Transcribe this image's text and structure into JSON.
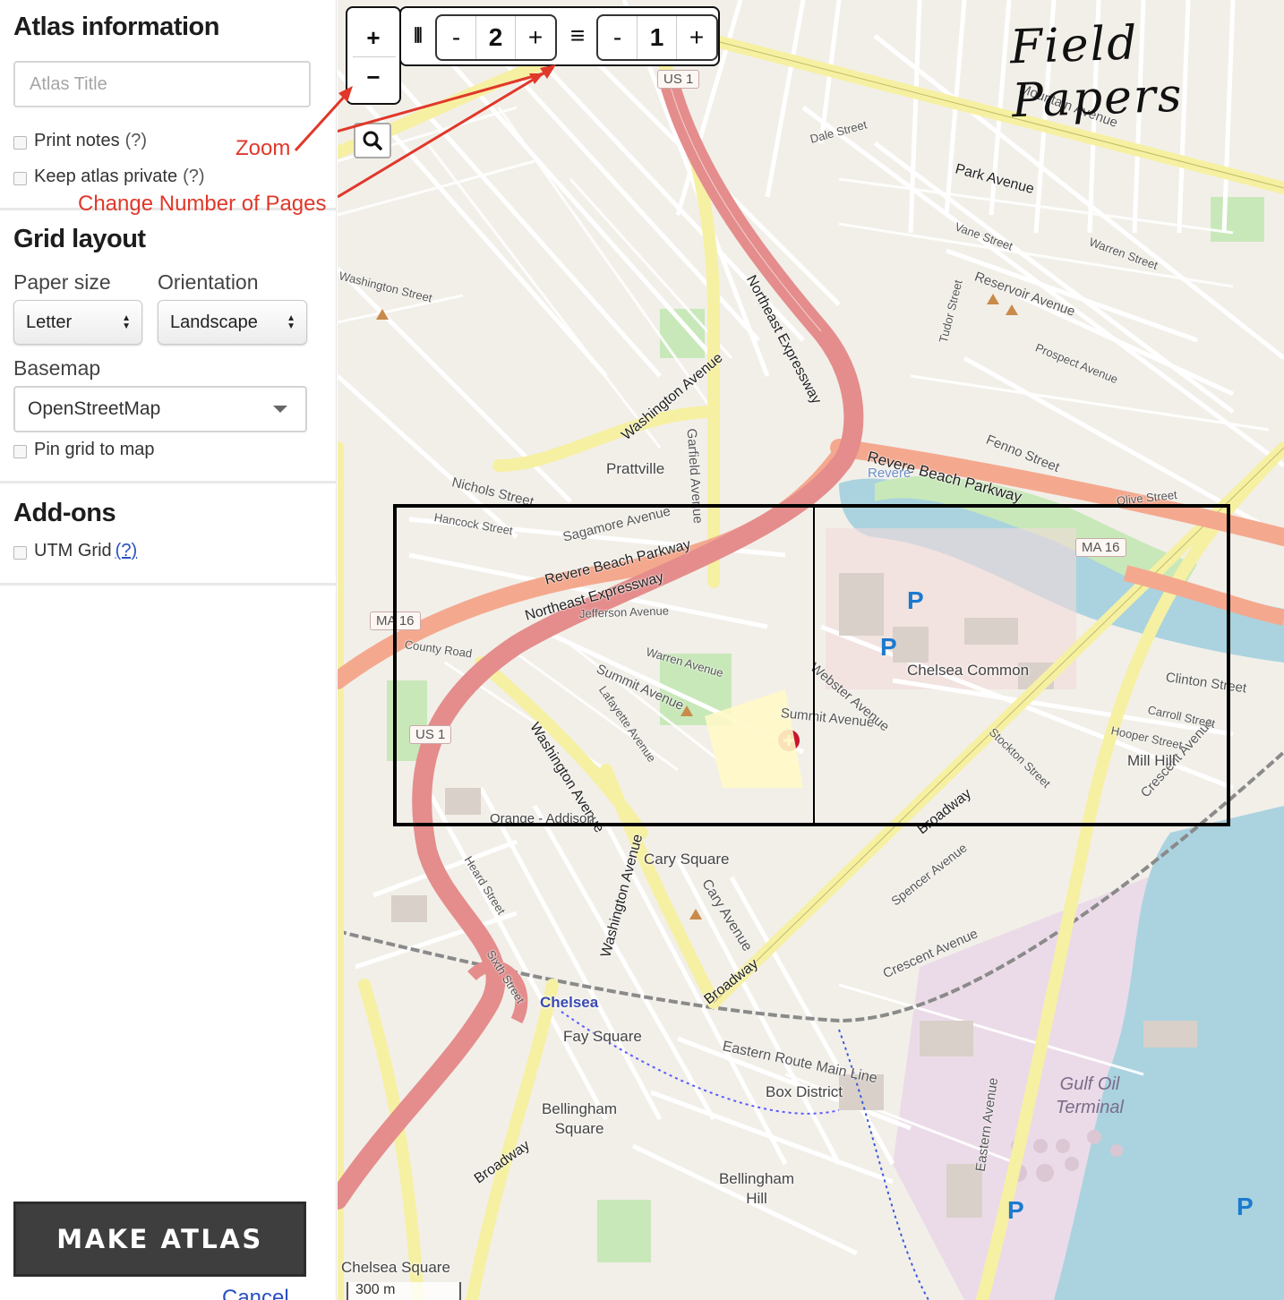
{
  "sidebar": {
    "atlas_info_title": "Atlas information",
    "atlas_title_placeholder": "Atlas Title",
    "print_notes_label": "Print notes",
    "print_notes_help": "(?)",
    "private_label": "Keep atlas private",
    "private_help": "(?)",
    "grid_title": "Grid layout",
    "paper_size_label": "Paper size",
    "paper_size_value": "Letter",
    "orientation_label": "Orientation",
    "orientation_value": "Landscape",
    "basemap_label": "Basemap",
    "basemap_value": "OpenStreetMap",
    "pin_grid_label": "Pin grid to map",
    "addons_title": "Add-ons",
    "utm_label": "UTM Grid",
    "utm_help": "(?)",
    "make_atlas_label": "MAKE ATLAS",
    "cancel_label": "Cancel"
  },
  "map": {
    "zoom_in": "+",
    "zoom_out": "−",
    "columns_count": "2",
    "rows_count": "1",
    "minus": "-",
    "plus": "+",
    "logo_text": "Field Papers",
    "scale_text": "300 m",
    "annotations": {
      "zoom": "Zoom",
      "pages": "Change Number of Pages"
    },
    "shields": [
      "US 1",
      "MA 16",
      "MA 16",
      "US 1"
    ],
    "places": [
      "Prattville",
      "Chelsea Common",
      "Cary Square",
      "Fay Square",
      "Bellingham Square",
      "Box District",
      "Bellingham Hill",
      "Chelsea Square",
      "Mill Hill",
      "Chelsea",
      "Gulf Oil Terminal",
      "Orange - Addison",
      "Revere"
    ],
    "streets": [
      "Revere Beach Parkway",
      "Northeast Expressway",
      "Washington Avenue",
      "Broadway",
      "Park Avenue",
      "Eastern Avenue",
      "Crescent Avenue",
      "Summit Avenue",
      "Sagamore Avenue",
      "Webster Avenue",
      "Garfield Avenue",
      "Spencer Avenue",
      "Clinton Street",
      "Reservoir Avenue",
      "Mountain Avenue",
      "Eastern Route Main Line",
      "Nichols Street",
      "Warren Avenue",
      "Jefferson Avenue",
      "Lafayette Avenue",
      "Hancock Street",
      "Fenno Street",
      "Prospect Avenue",
      "Washington Street",
      "Cary Avenue",
      "Vane Street",
      "Warren Street",
      "Dale Street",
      "Hooper Street",
      "Carroll Street",
      "Stockton Street",
      "Tudor Street",
      "Sixth Street",
      "Heard Street",
      "County Road",
      "Olive Street"
    ]
  },
  "colors": {
    "motorway": "#e48d8c",
    "trunk": "#f4a98f",
    "primary": "#f6f0a3",
    "water": "#aad3df",
    "industrial": "#ebdbe8",
    "park": "#c8e8b9",
    "annotation": "#e0382a"
  }
}
